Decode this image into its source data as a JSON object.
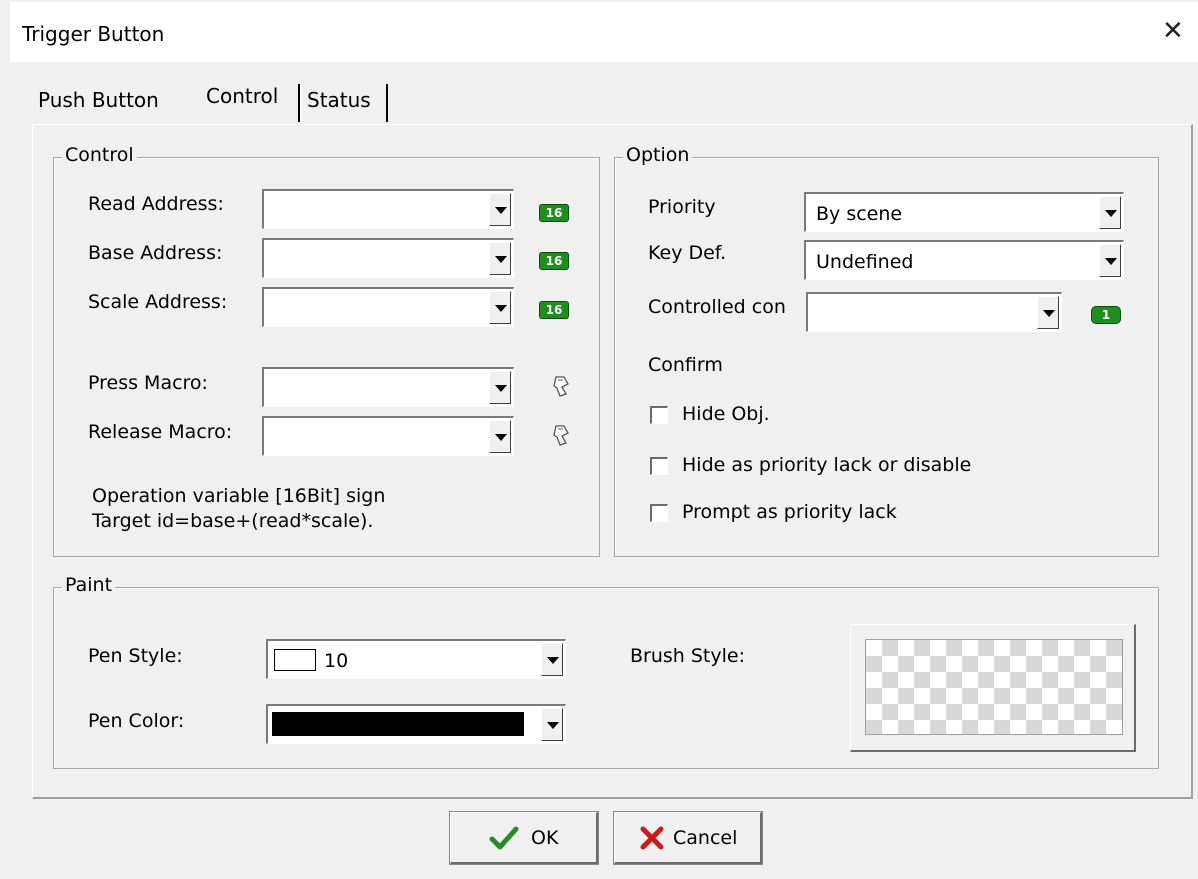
{
  "window": {
    "title": "Trigger Button",
    "close_icon": "close-icon"
  },
  "tabs": [
    {
      "label": "Push Button",
      "active": false
    },
    {
      "label": "Control",
      "active": true
    },
    {
      "label": "Status",
      "active": false
    }
  ],
  "control_group": {
    "title": "Control",
    "read_address": {
      "label": "Read Address:",
      "value": "",
      "badge": "16"
    },
    "base_address": {
      "label": "Base Address:",
      "value": "",
      "badge": "16"
    },
    "scale_address": {
      "label": "Scale Address:",
      "value": "",
      "badge": "16"
    },
    "press_macro": {
      "label": "Press Macro:",
      "value": ""
    },
    "release_macro": {
      "label": "Release Macro:",
      "value": ""
    },
    "note_line1": "Operation variable [16Bit] sign",
    "note_line2": "Target id=base+(read*scale)."
  },
  "option_group": {
    "title": "Option",
    "priority": {
      "label": "Priority",
      "value": "By scene"
    },
    "key_def": {
      "label": "Key Def.",
      "value": "Undefined"
    },
    "controlled_con": {
      "label": "Controlled con",
      "value": "",
      "badge": "1"
    },
    "confirm_label": "Confirm",
    "checkboxes": [
      {
        "label": "Hide Obj.",
        "checked": false
      },
      {
        "label": "Hide as priority lack or disable",
        "checked": false
      },
      {
        "label": "Prompt as priority lack",
        "checked": false
      }
    ]
  },
  "paint_group": {
    "title": "Paint",
    "pen_style": {
      "label": "Pen Style:",
      "value": "10"
    },
    "pen_color": {
      "label": "Pen Color:",
      "color": "#000000"
    },
    "brush_style": {
      "label": "Brush Style:"
    }
  },
  "buttons": {
    "ok": {
      "label": "OK",
      "icon": "checkmark-icon"
    },
    "cancel": {
      "label": "Cancel",
      "icon": "x-icon"
    }
  },
  "colors": {
    "badge_green": "#1e8f1e",
    "ok_check": "#2a8a2a",
    "cancel_x": "#cc1a1a"
  }
}
